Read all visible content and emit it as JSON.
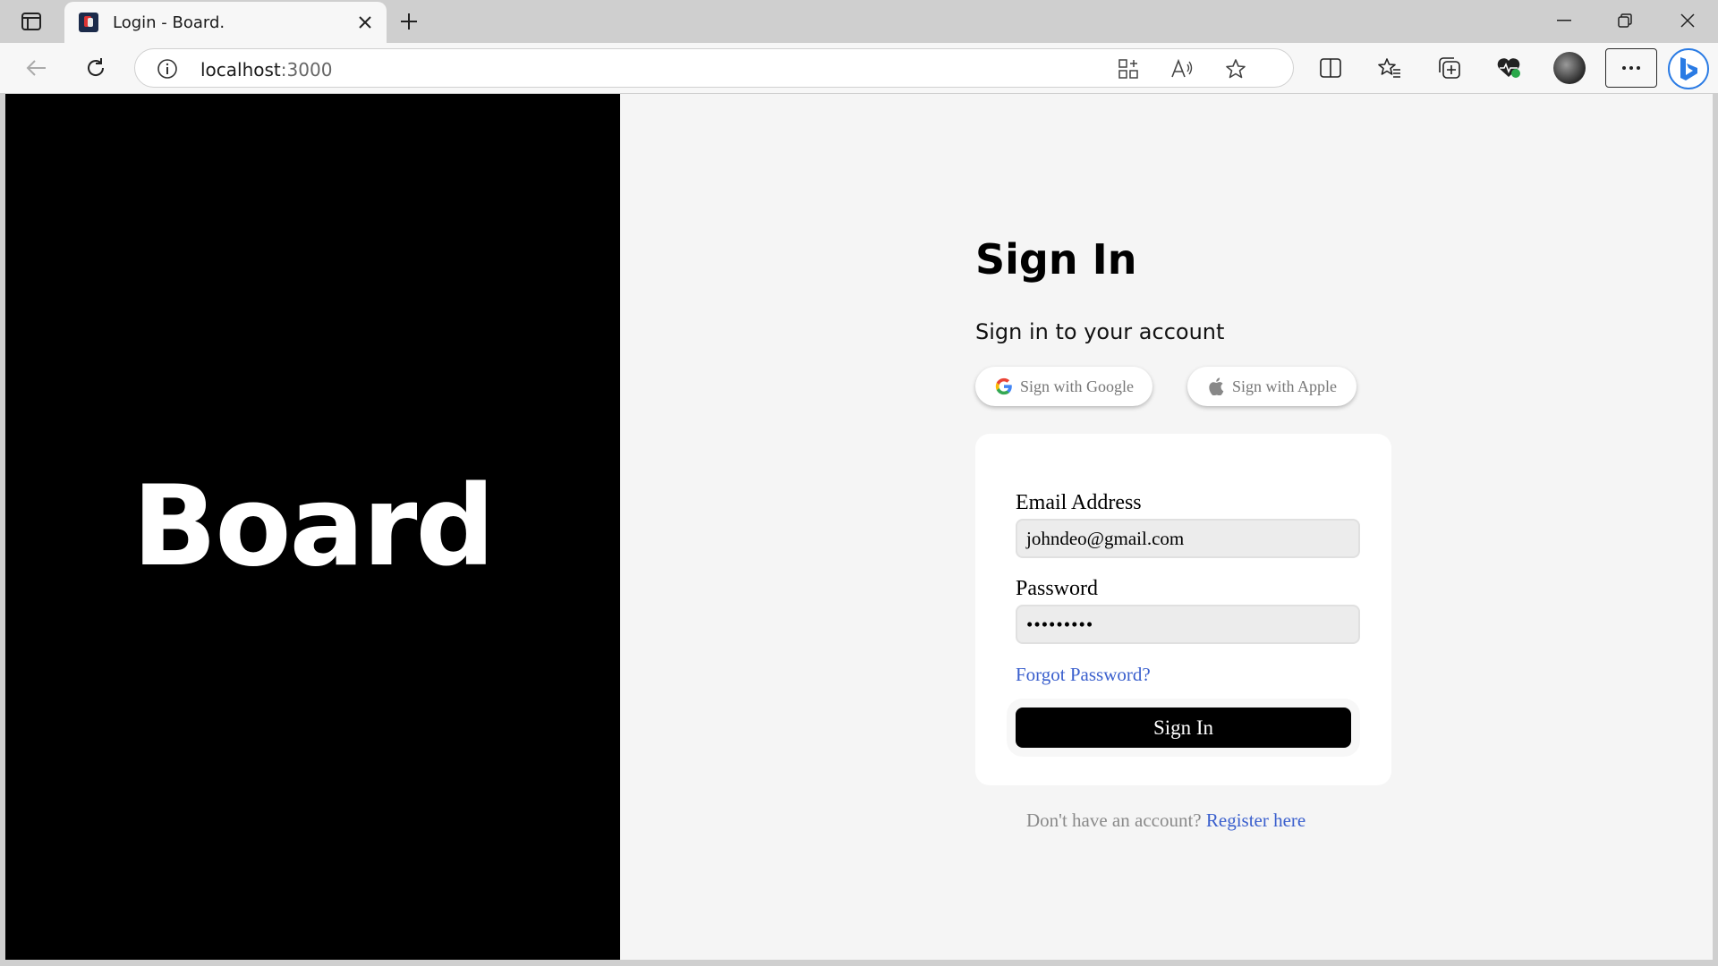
{
  "browser": {
    "tab": {
      "title": "Login - Board."
    },
    "address": {
      "host": "localhost",
      "port": ":3000"
    },
    "icons": [
      "tab-actions-icon",
      "close-icon",
      "plus-icon",
      "minimize-icon",
      "restore-icon",
      "back-icon",
      "refresh-icon",
      "info-icon",
      "apps-icon",
      "read-aloud-icon",
      "star-icon",
      "split-screen-icon",
      "favorites-icon",
      "collections-icon",
      "browser-essentials-icon",
      "more-icon",
      "bing-icon"
    ]
  },
  "brand": {
    "name": "Board"
  },
  "signin": {
    "heading": "Sign In",
    "subheading": "Sign in to your account",
    "google_label": "Sign with Google",
    "apple_label": "Sign with Apple",
    "email_label": "Email Address",
    "email_value": "johndeo@gmail.com",
    "password_label": "Password",
    "password_value": "•••••••••",
    "forgot_label": "Forgot Password?",
    "submit_label": "Sign In",
    "register_prompt": "Don't have an account?",
    "register_link": "Register here"
  },
  "colors": {
    "left_panel": "#000000",
    "page_bg": "#f5f5f5",
    "link": "#3a5fcd",
    "button": "#000000"
  }
}
